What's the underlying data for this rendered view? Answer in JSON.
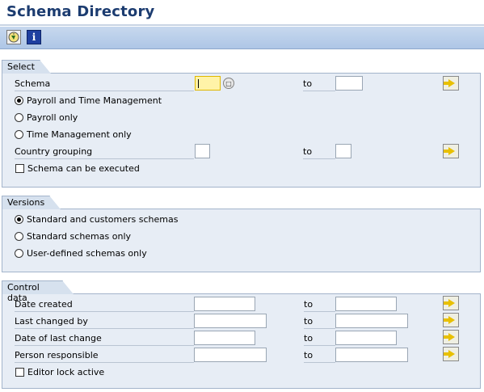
{
  "title": "Schema Directory",
  "toolbar": {
    "execute_icon": "execute-icon",
    "info_icon": "info-icon",
    "info_glyph": "i"
  },
  "select": {
    "title": "Select",
    "schema_label": "Schema",
    "to_label": "to",
    "payroll_and_time": "Payroll and Time Management",
    "payroll_only": "Payroll only",
    "time_only": "Time Management only",
    "country_grouping_label": "Country grouping",
    "executable_label": "Schema can be executed",
    "selected_option": "Payroll and Time Management"
  },
  "versions": {
    "title": "Versions",
    "standard_and_customer": "Standard and customers schemas",
    "standard_only": "Standard schemas only",
    "user_defined_only": "User-defined schemas only",
    "selected_option": "Standard and customers schemas"
  },
  "control": {
    "title": "Control data",
    "date_created": "Date created",
    "last_changed_by": "Last changed by",
    "date_last_change": "Date of last change",
    "person_responsible": "Person responsible",
    "editor_lock": "Editor lock active",
    "to_label": "to"
  },
  "colors": {
    "title": "#1c3c70",
    "toolbar": "#b8cfeb",
    "group_bg": "#e7edf5",
    "focus_field": "#fff3a8",
    "arrow": "#e8c000"
  }
}
